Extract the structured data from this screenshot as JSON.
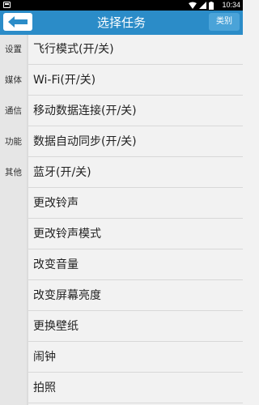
{
  "status_bar": {
    "time": "10:34"
  },
  "header": {
    "title": "选择任务",
    "category_label": "类别"
  },
  "sidebar": {
    "items": [
      {
        "label": "设置"
      },
      {
        "label": "媒体"
      },
      {
        "label": "通信"
      },
      {
        "label": "功能"
      },
      {
        "label": "其他"
      }
    ]
  },
  "tasks": [
    {
      "label": "飞行模式(开/关)"
    },
    {
      "label": "Wi-Fi(开/关)"
    },
    {
      "label": "移动数据连接(开/关)"
    },
    {
      "label": "数据自动同步(开/关)"
    },
    {
      "label": "蓝牙(开/关)"
    },
    {
      "label": "更改铃声"
    },
    {
      "label": "更改铃声模式"
    },
    {
      "label": "改变音量"
    },
    {
      "label": "改变屏幕亮度"
    },
    {
      "label": "更换壁纸"
    },
    {
      "label": "闹钟"
    },
    {
      "label": "拍照"
    }
  ],
  "colors": {
    "header_bg": "#2b8cc8",
    "category_bg": "#4aa3d8"
  }
}
